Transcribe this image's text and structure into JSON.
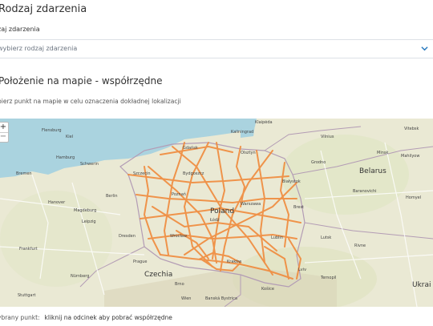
{
  "form": {
    "title": "Rodzaj zdarzenia",
    "field_label": "zaj zdarzenia",
    "select_placeholder": "wybierz rodzaj zdarzenia"
  },
  "location": {
    "title": "Położenie na mapie - współrzędne",
    "hint": "bierz punkt na mapie w celu oznaczenia dokładnej lokalizacji"
  },
  "map": {
    "zoom_in": "+",
    "zoom_out": "−",
    "countries": [
      "Poland",
      "Belarus",
      "Czechia",
      "Ukrai"
    ],
    "cities": [
      "Klaipėda",
      "Vilnius",
      "Kaliningrad",
      "Flensburg",
      "Kiel",
      "Gdańsk",
      "Olsztyn",
      "Grodno",
      "Hamburg",
      "Schwerin",
      "Szczecin",
      "Bydgoszcz",
      "Białystok",
      "Baranovichi",
      "Bremen",
      "Hanover",
      "Berlin",
      "Poznań",
      "Magdeburg",
      "Warszawa",
      "Brest",
      "Leipzig",
      "Łódź",
      "Lublin",
      "Dresden",
      "Wrocław",
      "Frankfurt",
      "Prague",
      "Kraków",
      "Lviv",
      "Ternopil",
      "Nürnberg",
      "Brno",
      "Košice",
      "Stuttgart",
      "Wien",
      "Banská Bystrica",
      "Mahilyow",
      "Minsk",
      "Vitebsk",
      "Homyel",
      "Lutsk",
      "Rivne"
    ],
    "line_color": "#f08a3c"
  },
  "status": {
    "label": "ybrany punkt:",
    "value": "kliknij na odcinek aby pobrać współrzędne"
  }
}
